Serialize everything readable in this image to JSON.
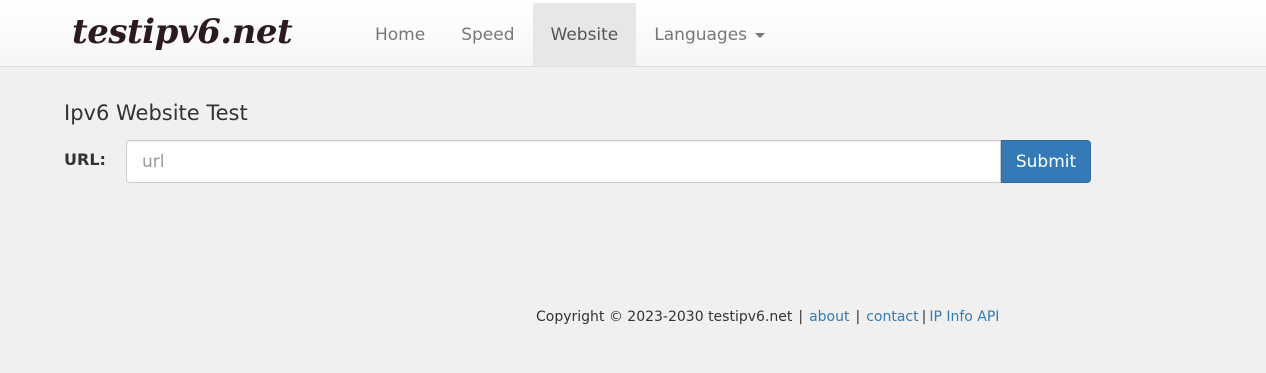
{
  "brand": {
    "name": "testipv6.net"
  },
  "nav": {
    "items": [
      {
        "label": "Home"
      },
      {
        "label": "Speed"
      },
      {
        "label": "Website"
      },
      {
        "label": "Languages"
      }
    ],
    "active": "Website"
  },
  "main": {
    "title": "Ipv6 Website Test",
    "url_label": "URL:",
    "url_placeholder": "url",
    "url_value": "",
    "submit_label": "Submit"
  },
  "footer": {
    "copyright": "Copyright © 2023-2030 testipv6.net",
    "separator": "|",
    "links": [
      {
        "label": "about"
      },
      {
        "label": "contact"
      },
      {
        "label": "IP Info API"
      }
    ]
  },
  "colors": {
    "primary": "#337ab7",
    "background": "#f0f0f0",
    "active_nav_bg": "#e7e7e7"
  }
}
